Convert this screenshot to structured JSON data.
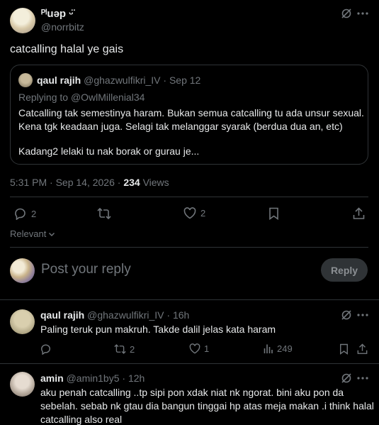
{
  "tweet": {
    "author_name": "ᴾˡuǝp ᵕ̈",
    "handle": "@norrbitz",
    "text": "catcalling halal ye gais",
    "timestamp": "5:31 PM · Sep 14, 2026 · ",
    "views_count": "234",
    "views_label": " Views",
    "replies": "2",
    "likes": "2"
  },
  "quote": {
    "author_name": "qaul rajih",
    "handle": "@ghazwulfikri_IV",
    "date": " · Sep 12",
    "replying_prefix": "Replying to ",
    "replying_to": "@OwlMillenial34",
    "line1": "Catcalling tak semestinya haram. Bukan semua catcalling tu ada unsur sexual.",
    "line2": "Kena tgk keadaan juga. Selagi tak melanggar syarak (berdua dua an, etc)",
    "line3": "Kadang2 lelaki tu nak borak or gurau je..."
  },
  "sort": {
    "label": "Relevant"
  },
  "composer": {
    "placeholder": "Post your reply",
    "button": "Reply"
  },
  "replies": [
    {
      "author_name": "qaul rajih",
      "handle": "@ghazwulfikri_IV",
      "time": " · 16h",
      "text": "Paling teruk pun makruh. Takde dalil jelas kata haram",
      "retweets": "2",
      "likes": "1",
      "views": "249"
    },
    {
      "author_name": "amin",
      "handle": "@amin1by5",
      "time": " · 12h",
      "line1": "aku penah catcalling ..tp sipi pon xdak niat nk ngorat. bini aku pon da",
      "line2": "sebelah. sebab nk gtau dia bangun tinggai hp atas meja makan .i think halal",
      "line3": "catcalling also real"
    }
  ],
  "colors": {
    "background": "#000000",
    "text": "#e7e9ea",
    "muted": "#71767b",
    "border": "#2f3336",
    "accent": "#1d9bf0"
  }
}
